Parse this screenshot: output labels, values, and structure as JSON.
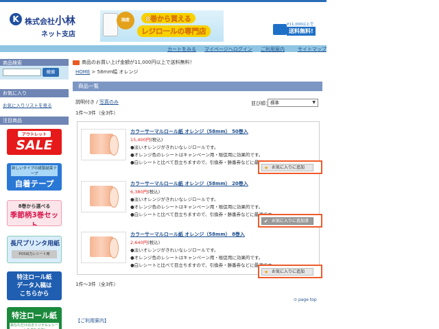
{
  "header": {
    "logo_mark": "K",
    "company": "株式会社",
    "company_name": "小林",
    "branch": "ネット支店",
    "banner_medal": "国産",
    "banner_line1": "8巻から買える",
    "banner_line2": "レジロールの専門店",
    "shipping_small": "¥11,000以上で",
    "shipping_big": "送料無料!"
  },
  "topnav": [
    "カートをみる",
    "マイページへログイン",
    "ご利用案内",
    "サイトマップ"
  ],
  "notice": "商品のお買い上げ金額が11,000円以上で送料無料！",
  "breadcrumb": {
    "home": "HOME",
    "sep": ">",
    "current": "58mm幅 オレンジ"
  },
  "sidebar": {
    "search_title": "商品検索",
    "search_button": "検索",
    "favorites_title": "お気に入り",
    "favorites_link": "お気に入りリストを見る",
    "featured_title": "注目商品",
    "banner_sale_top": "アウトレット",
    "banner_sale": "SALE",
    "banner_tape_top": "新しいタイプの紙製結束テープ",
    "banner_tape": "自着テープ",
    "banner_season_top": "8巻から選べる",
    "banner_season": "季節柄3巻セット",
    "banner_printer": "長尺プリンタ用紙",
    "banner_printer_sub": "POS出力レシート用",
    "banner_special_l1": "特注ロール紙",
    "banner_special_l2": "データ入稿は",
    "banner_special_l3": "こちらから",
    "banner_special2": "特注ロール紙",
    "banner_special2_sub": "あなただけのオリジナルレシートを作れます!"
  },
  "main": {
    "list_title": "商品一覧",
    "view_with_desc": "説明付き",
    "view_sep": "/",
    "view_photo": "写真のみ",
    "sort_label": "並び順：",
    "sort_value": "標準",
    "count": "1件〜3件（全3件）",
    "desc1": "●淡いオレンジがきれいなレジロールです。",
    "desc2": "●オレンジ色のレシートはキャンペーン用・販促用に効果的です。",
    "desc3": "●白レシートと比べて目立ちますので、引換券・勝番券などに最適です。",
    "fav_label": "お気に入りに追加",
    "fav_added_label": "お気に入りに追加済",
    "items": [
      {
        "name": "カラーサーマルロール紙 オレンジ（58mm） 50巻入",
        "price": "15,400円",
        "tax": "(税込)"
      },
      {
        "name": "カラーサーマルロール紙 オレンジ（58mm） 20巻入",
        "price": "6,380円",
        "tax": "(税込)"
      },
      {
        "name": "カラーサーマルロール紙 オレンジ（58mm） 8巻入",
        "price": "2,640円",
        "tax": "(税込)"
      }
    ],
    "page_top": "page top",
    "guide": "【ご利用案内】"
  },
  "colors": {
    "accent": "#2a6db5",
    "price": "#e02020",
    "highlight": "#f05a28"
  }
}
